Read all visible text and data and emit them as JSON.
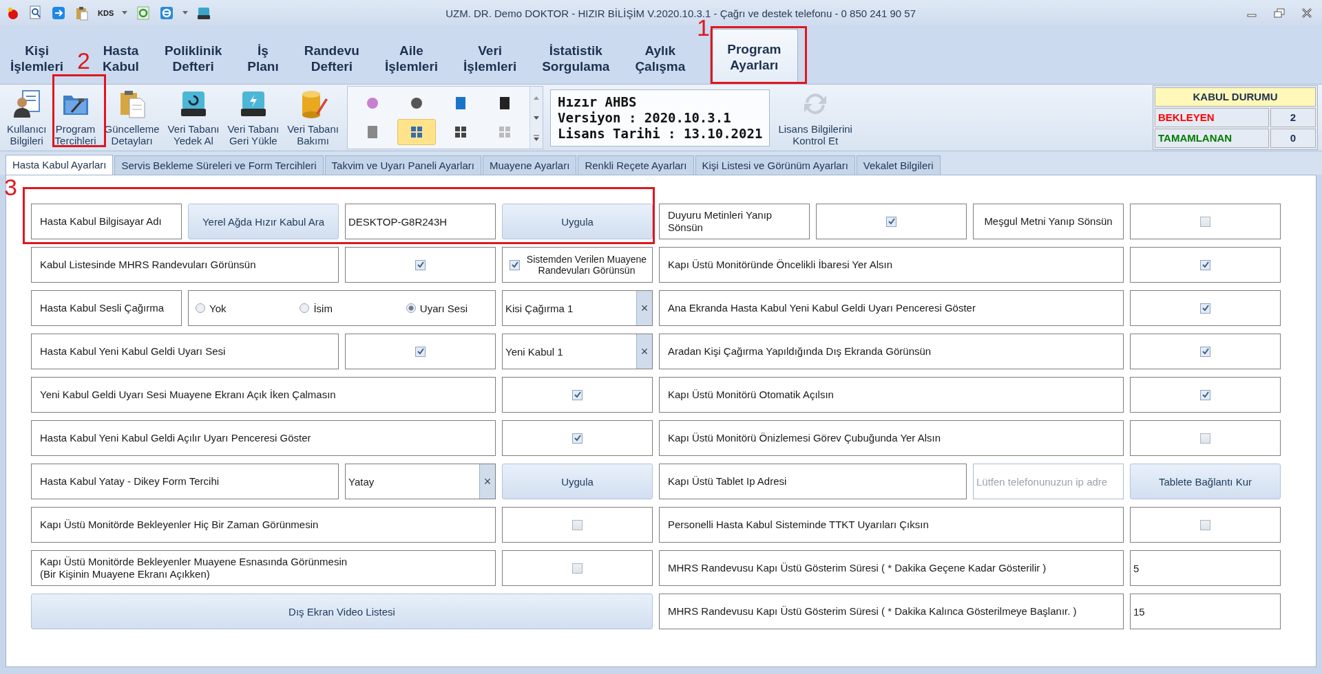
{
  "window": {
    "title": "UZM. DR. Demo DOKTOR - HIZIR BİLİŞİM V.2020.10.3.1 - Çağrı ve destek telefonu - 0 850 241 90 57",
    "quick_access_label": "KDS"
  },
  "ribbon_tabs": [
    {
      "lines": [
        "Kişi",
        "İşlemleri"
      ],
      "selected": false
    },
    {
      "lines": [
        "Hasta",
        "Kabul"
      ],
      "selected": false
    },
    {
      "lines": [
        "Poliklinik",
        "Defteri"
      ],
      "selected": false
    },
    {
      "lines": [
        "İş",
        "Planı"
      ],
      "selected": false
    },
    {
      "lines": [
        "Randevu",
        "Defteri"
      ],
      "selected": false
    },
    {
      "lines": [
        "Aile",
        "İşlemleri"
      ],
      "selected": false
    },
    {
      "lines": [
        "Veri",
        "İşlemleri"
      ],
      "selected": false
    },
    {
      "lines": [
        "İstatistik",
        "Sorgulama"
      ],
      "selected": false
    },
    {
      "lines": [
        "Aylık",
        "Çalışma"
      ],
      "selected": false
    },
    {
      "lines": [
        "Program",
        "Ayarları"
      ],
      "selected": true
    }
  ],
  "toolbar": [
    {
      "lines": [
        "Kullanıcı",
        "Bilgileri"
      ]
    },
    {
      "lines": [
        "Program",
        "Tercihleri"
      ]
    },
    {
      "lines": [
        "Güncelleme",
        "Detayları"
      ]
    },
    {
      "lines": [
        "Veri Tabanı",
        "Yedek Al"
      ]
    },
    {
      "lines": [
        "Veri Tabanı",
        "Geri Yükle"
      ]
    },
    {
      "lines": [
        "Veri Tabanı",
        "Bakımı"
      ]
    }
  ],
  "gallery": [
    {
      "selected": false
    },
    {
      "selected": false
    },
    {
      "selected": false
    },
    {
      "selected": false
    },
    {
      "selected": false
    },
    {
      "selected": true
    },
    {
      "selected": false
    },
    {
      "selected": false
    }
  ],
  "about": [
    "Hızır AHBS",
    "Versiyon : 2020.10.3.1",
    "Lisans Tarihi : 13.10.2021"
  ],
  "license_button": [
    "Lisans Bilgilerini",
    "Kontrol Et"
  ],
  "status_panel": {
    "title": "KABUL DURUMU",
    "rows": [
      {
        "label": "BEKLEYEN",
        "value": "2",
        "color": "#ff0000"
      },
      {
        "label": "TAMAMLANAN",
        "value": "0",
        "color": "#007a00"
      }
    ]
  },
  "settings_tabs": [
    {
      "label": "Hasta Kabul Ayarları",
      "selected": true
    },
    {
      "label": "Servis Bekleme Süreleri ve Form Tercihleri",
      "selected": false
    },
    {
      "label": "Takvim ve Uyarı Paneli Ayarları",
      "selected": false
    },
    {
      "label": "Muayene Ayarları",
      "selected": false
    },
    {
      "label": "Renkli Reçete Ayarları",
      "selected": false
    },
    {
      "label": "Kişi Listesi ve Görünüm Ayarları",
      "selected": false
    },
    {
      "label": "Vekalet Bilgileri",
      "selected": false
    }
  ],
  "form_rows": [
    {
      "cells": [
        {
          "kind": "label",
          "text": "Hasta Kabul Bilgisayar Adı"
        },
        {
          "kind": "button",
          "text": "Yerel Ağda Hızır Kabul Ara"
        },
        {
          "kind": "text",
          "value": "DESKTOP-G8R243H"
        },
        {
          "kind": "button",
          "text": "Uygula"
        },
        {
          "kind": "label",
          "text": "Duyuru Metinleri Yanıp Sönsün"
        },
        {
          "kind": "check",
          "checked": true
        },
        {
          "kind": "label",
          "text": "Meşgul Metni Yanıp Sönsün"
        },
        {
          "kind": "check",
          "checked": false
        }
      ]
    },
    {
      "cells": [
        {
          "kind": "label",
          "text": "Kabul Listesinde MHRS Randevuları Görünsün"
        },
        {
          "kind": "check",
          "checked": true
        },
        {
          "kind": "checklabel",
          "text": "Sistemden Verilen Muayene Randevuları Görünsün",
          "checked": true
        },
        {
          "kind": "label",
          "text": "Kapı Üstü Monitöründe Öncelikli İbaresi Yer Alsın"
        },
        {
          "kind": "check",
          "checked": true
        }
      ]
    },
    {
      "cells": [
        {
          "kind": "label",
          "text": "Hasta Kabul Sesli Çağırma"
        },
        {
          "kind": "radios",
          "options": [
            {
              "label": "Yok",
              "selected": false
            },
            {
              "label": "İsim",
              "selected": false
            },
            {
              "label": "Uyarı Sesi",
              "selected": true
            }
          ]
        },
        {
          "kind": "combo",
          "value": "Kisi Çağırma 1",
          "clear": "×"
        },
        {
          "kind": "label",
          "text": "Ana Ekranda Hasta Kabul Yeni Kabul Geldi Uyarı Penceresi Göster"
        },
        {
          "kind": "check",
          "checked": true
        }
      ]
    },
    {
      "cells": [
        {
          "kind": "label",
          "text": "Hasta Kabul Yeni Kabul Geldi Uyarı Sesi"
        },
        {
          "kind": "check",
          "checked": true
        },
        {
          "kind": "combo",
          "value": "Yeni Kabul 1",
          "clear": "×"
        },
        {
          "kind": "label",
          "text": "Aradan Kişi Çağırma Yapıldığında Dış Ekranda Görünsün"
        },
        {
          "kind": "check",
          "checked": true
        }
      ]
    },
    {
      "cells": [
        {
          "kind": "label",
          "text": "Yeni Kabul Geldi Uyarı Sesi Muayene Ekranı Açık İken Çalmasın"
        },
        {
          "kind": "check",
          "checked": true
        },
        {
          "kind": "label",
          "text": "Kapı Üstü Monitörü Otomatik Açılsın"
        },
        {
          "kind": "check",
          "checked": true
        }
      ]
    },
    {
      "cells": [
        {
          "kind": "label",
          "text": "Hasta Kabul Yeni Kabul Geldi Açılır Uyarı Penceresi Göster"
        },
        {
          "kind": "check",
          "checked": true
        },
        {
          "kind": "label",
          "text": "Kapı Üstü Monitörü Önizlemesi Görev Çubuğunda Yer Alsın"
        },
        {
          "kind": "check",
          "checked": false
        }
      ]
    },
    {
      "cells": [
        {
          "kind": "label",
          "text": "Hasta Kabul Yatay - Dikey Form Tercihi"
        },
        {
          "kind": "combo",
          "value": "Yatay",
          "clear": "×"
        },
        {
          "kind": "button",
          "text": "Uygula"
        },
        {
          "kind": "label",
          "text": "Kapı Üstü Tablet Ip Adresi"
        },
        {
          "kind": "text",
          "placeholder": "Lütfen telefonunuzun ip adre"
        },
        {
          "kind": "button",
          "text": "Tablete Bağlantı Kur"
        }
      ]
    },
    {
      "cells": [
        {
          "kind": "label",
          "text": "Kapı Üstü Monitörde Bekleyenler Hiç Bir Zaman Görünmesin"
        },
        {
          "kind": "check",
          "checked": false
        },
        {
          "kind": "label",
          "text": "Personelli Hasta Kabul Sisteminde TTKT Uyarıları Çıksın"
        },
        {
          "kind": "check",
          "checked": false
        }
      ]
    },
    {
      "cells": [
        {
          "kind": "label",
          "text": "Kapı Üstü Monitörde Bekleyenler Muayene Esnasında Görünmesin\n(Bir Kişinin Muayene Ekranı Açıkken)"
        },
        {
          "kind": "check",
          "checked": false
        },
        {
          "kind": "label",
          "text": "MHRS Randevusu Kapı Üstü Gösterim Süresi ( * Dakika Geçene Kadar Gösterilir )"
        },
        {
          "kind": "text",
          "value": "5"
        }
      ]
    },
    {
      "cells": [
        {
          "kind": "button",
          "text": "Dış Ekran Video Listesi"
        },
        {
          "kind": "label",
          "text": "MHRS Randevusu Kapı Üstü Gösterim Süresi ( * Dakika Kalınca Gösterilmeye Başlanır. )"
        },
        {
          "kind": "text",
          "value": "15"
        }
      ]
    }
  ],
  "annotations": [
    {
      "number": "1"
    },
    {
      "number": "2"
    },
    {
      "number": "3"
    }
  ]
}
